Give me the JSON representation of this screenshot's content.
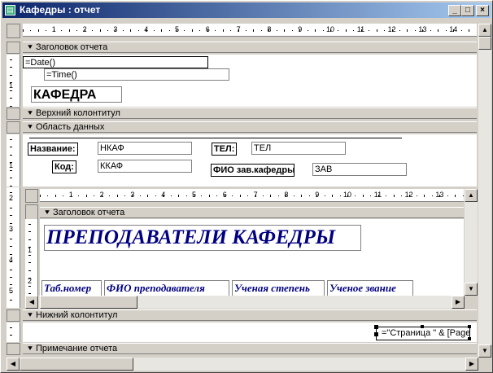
{
  "window": {
    "title": "Кафедры : отчет",
    "minimize": "_",
    "maximize": "□",
    "close": "×"
  },
  "ruler_numbers": [
    "1",
    "2",
    "3",
    "4",
    "5",
    "6",
    "7",
    "8",
    "9",
    "10",
    "11",
    "12",
    "13",
    "14"
  ],
  "inner_ruler_numbers": [
    "1",
    "2",
    "3",
    "4",
    "5",
    "6",
    "7",
    "8",
    "9",
    "10",
    "11",
    "12",
    "13"
  ],
  "vruler_main": [
    "1",
    "2",
    "3",
    "4",
    "5"
  ],
  "vruler_inner": [
    "1",
    "2"
  ],
  "sections": {
    "report_header": "Заголовок отчета",
    "page_header": "Верхний колонтитул",
    "detail": "Область данных",
    "page_footer": "Нижний колонтитул",
    "report_footer": "Примечание отчета"
  },
  "report_header": {
    "date_expr": "=Date()",
    "time_expr": "=Time()",
    "title": "КАФЕДРА"
  },
  "detail": {
    "name_label": "Название:",
    "name_field": "НКАФ",
    "phone_label": "ТЕЛ:",
    "phone_field": "ТЕЛ",
    "code_label": "Код:",
    "code_field": "ККАФ",
    "head_label": "ФИО зав.кафедры",
    "head_field": "ЗАВ"
  },
  "subreport": {
    "section_header": "Заголовок отчета",
    "title": "ПРЕПОДАВАТЕЛИ КАФЕДРЫ",
    "columns": [
      "Таб.номер",
      "ФИО преподавателя",
      "Ученая степень",
      "Ученое звание"
    ]
  },
  "page_footer": {
    "page_expr": "=\"Страница \" & [Page]"
  },
  "colors": {
    "title_start": "#0a246a",
    "title_end": "#a6caf0",
    "subreport_text": "#000080"
  }
}
